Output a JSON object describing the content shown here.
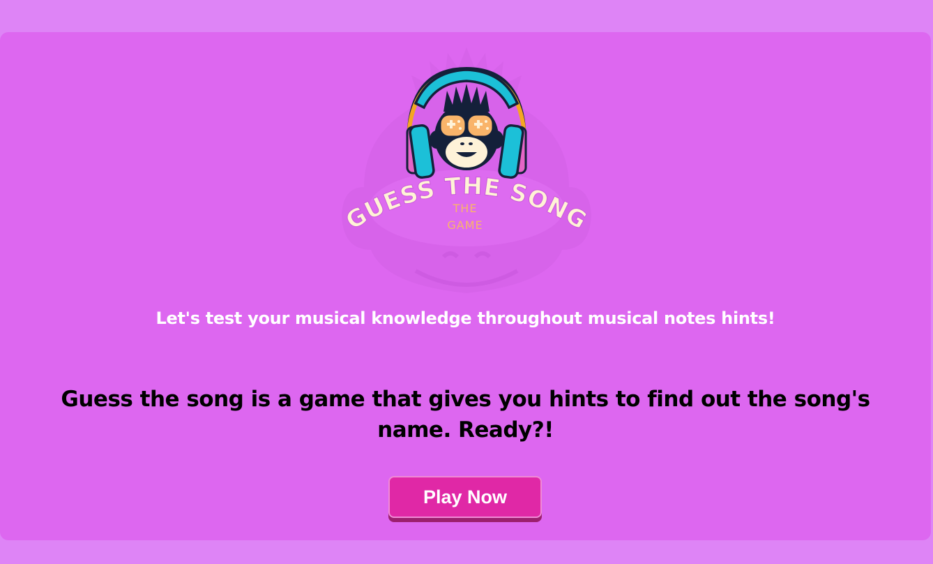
{
  "logo": {
    "icon": "monkey-headphones-icon",
    "title_text": "GUESS THE SONG",
    "subtitle_line1": "THE",
    "subtitle_line2": "GAME"
  },
  "tagline": "Let's test your musical knowledge throughout musical notes hints!",
  "description": "Guess the song is a game that gives you hints to find out the song's name. Ready?!",
  "play_button": {
    "label": "Play Now"
  },
  "colors": {
    "page_background": "#de84f6",
    "card_background": "#dd67f0",
    "button_background": "#e028a6",
    "button_shadow": "#9c1f6e",
    "headphone_band": "#1cc0d8",
    "logo_text": "#fff3d6",
    "logo_subtext": "#f9b46a"
  }
}
